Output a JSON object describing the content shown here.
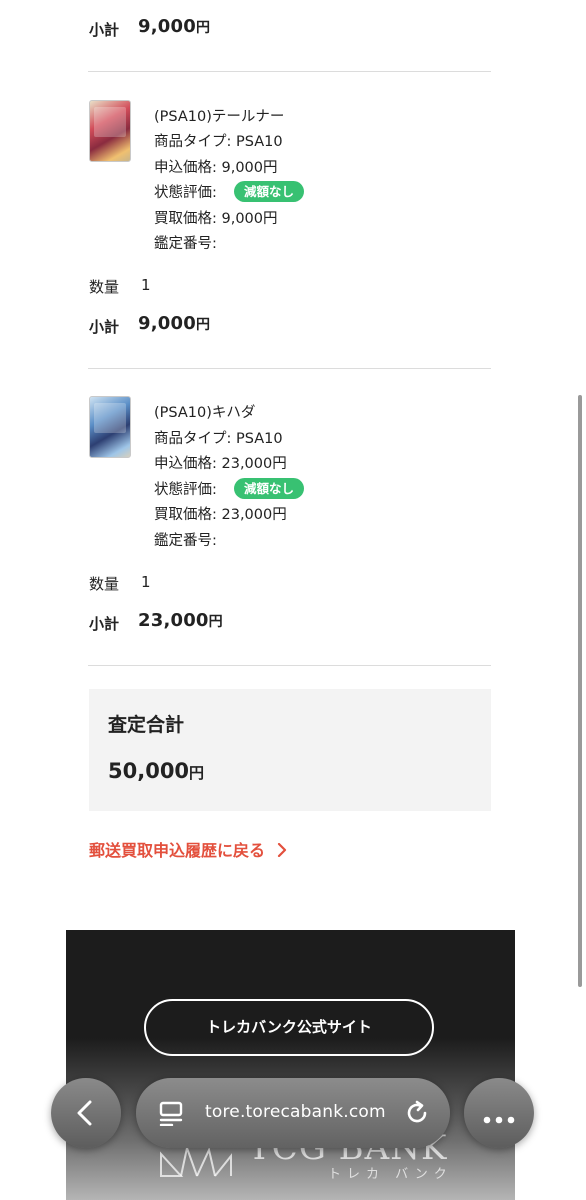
{
  "items": [
    {
      "subtotal_label": "小計",
      "subtotal_amount": "9,000",
      "subtotal_unit": "円"
    },
    {
      "name": "(PSA10)テールナー",
      "product_type": "商品タイプ: PSA10",
      "offer_price": "申込価格: 9,000円",
      "condition_label": "状態評価:",
      "condition_badge": "減額なし",
      "purchase_price": "買取価格: 9,000円",
      "cert_number": "鑑定番号:",
      "quantity_label": "数量",
      "quantity_value": "1",
      "subtotal_label": "小計",
      "subtotal_amount": "9,000",
      "subtotal_unit": "円"
    },
    {
      "name": "(PSA10)キハダ",
      "product_type": "商品タイプ: PSA10",
      "offer_price": "申込価格: 23,000円",
      "condition_label": "状態評価:",
      "condition_badge": "減額なし",
      "purchase_price": "買取価格: 23,000円",
      "cert_number": "鑑定番号:",
      "quantity_label": "数量",
      "quantity_value": "1",
      "subtotal_label": "小計",
      "subtotal_amount": "23,000",
      "subtotal_unit": "円"
    }
  ],
  "total": {
    "label": "査定合計",
    "amount": "50,000",
    "unit": "円"
  },
  "back_link": "郵送買取申込履歴に戻る",
  "footer": {
    "site_button": "トレカバンク公式サイト",
    "logo_text": "TCG BANK",
    "logo_kana": "トレカ バンク"
  },
  "browser": {
    "url": "tore.torecabank.com"
  },
  "colors": {
    "badge": "#38c172",
    "link": "#e3503d",
    "total_box": "#f3f3f3",
    "footer": "#1c1c1c"
  }
}
